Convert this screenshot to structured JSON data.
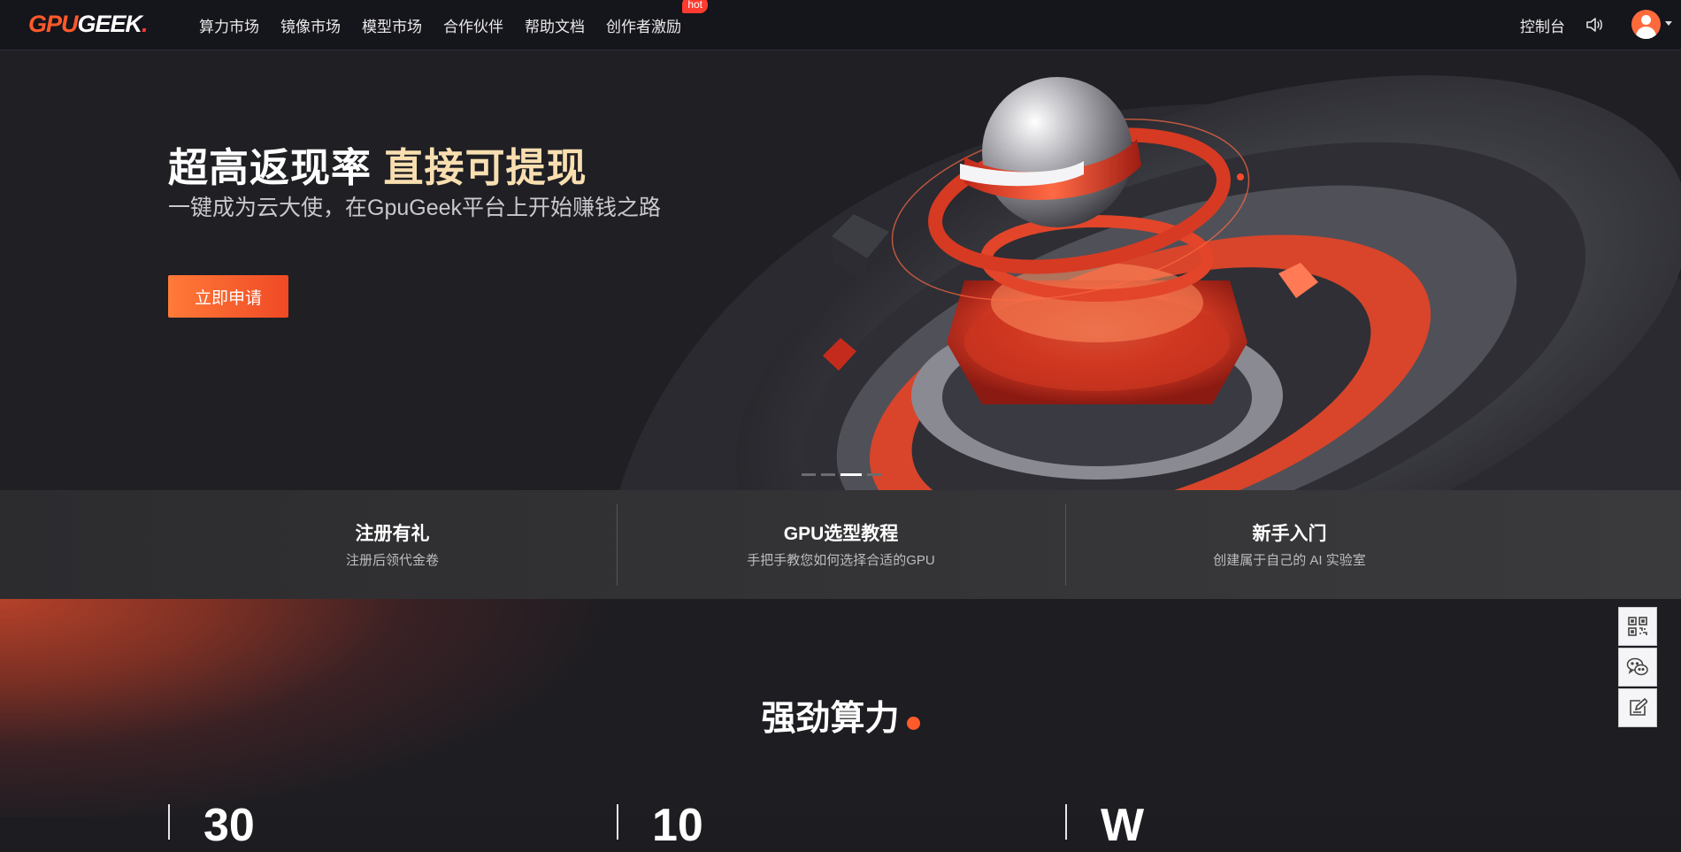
{
  "header": {
    "logo_text_main": "GPU",
    "logo_text_rest": "GEEK",
    "logo_dot": ".",
    "nav": [
      {
        "label": "算力市场"
      },
      {
        "label": "镜像市场"
      },
      {
        "label": "模型市场"
      },
      {
        "label": "合作伙伴"
      },
      {
        "label": "帮助文档"
      },
      {
        "label": "创作者激励",
        "badge": "hot"
      }
    ],
    "console_label": "控制台",
    "sound_icon": "speaker-icon",
    "avatar_icon": "user-avatar-icon"
  },
  "hero": {
    "title_main": "超高返现率",
    "title_highlight": "直接可提现",
    "subtitle": "一键成为云大使，在GpuGeek平台上开始赚钱之路",
    "cta_label": "立即申请",
    "carousel_total": 4,
    "carousel_active": 3
  },
  "features": [
    {
      "title": "注册有礼",
      "subtitle": "注册后领代金卷"
    },
    {
      "title": "GPU选型教程",
      "subtitle": "手把手教您如何选择合适的GPU"
    },
    {
      "title": "新手入门",
      "subtitle": "创建属于自己的 AI 实验室"
    }
  ],
  "power": {
    "title": "强劲算力",
    "stats": [
      "30",
      "10",
      "W"
    ]
  },
  "floating_tools": [
    "qrcode-icon",
    "wechat-icon",
    "feedback-icon"
  ],
  "colors": {
    "accent": "#ff5a2a",
    "header_bg": "#15151c",
    "highlight_text": "#f9dfb0"
  }
}
